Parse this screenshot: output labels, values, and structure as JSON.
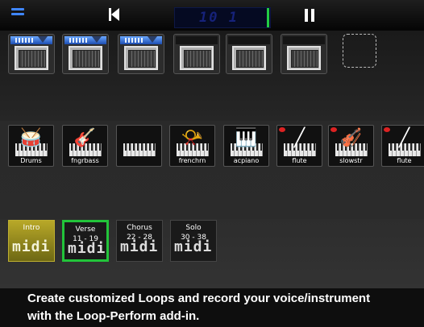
{
  "toolbar": {
    "lcd_text": "10 1",
    "accent": "#3f86ff",
    "lcd_bar_color": "#22cc44"
  },
  "loop_pads": [
    {
      "icon": "loop-pad-speaker-icon",
      "has_waveform": true
    },
    {
      "icon": "loop-pad-speaker-icon",
      "has_waveform": true
    },
    {
      "icon": "loop-pad-speaker-icon",
      "has_waveform": true
    },
    {
      "icon": "loop-pad-speaker-icon",
      "has_waveform": false
    },
    {
      "icon": "loop-pad-speaker-icon",
      "has_waveform": false
    },
    {
      "icon": "loop-pad-speaker-icon",
      "has_waveform": false
    }
  ],
  "instruments": [
    {
      "label": "Drums",
      "icon": "drum-kit-icon",
      "muted": false
    },
    {
      "label": "fngrbass",
      "icon": "bass-guitar-icon",
      "muted": false
    },
    {
      "label": "",
      "icon": "keyboard-icon",
      "muted": false
    },
    {
      "label": "frenchrn",
      "icon": "french-horn-icon",
      "muted": false
    },
    {
      "label": "acpiano",
      "icon": "grand-piano-icon",
      "muted": false
    },
    {
      "label": "flute",
      "icon": "flute-icon",
      "muted": true
    },
    {
      "label": "slowstr",
      "icon": "violin-icon",
      "muted": true
    },
    {
      "label": "flute",
      "icon": "flute-icon",
      "muted": true
    }
  ],
  "sections": [
    {
      "name": "Intro",
      "range": "",
      "selected": false,
      "active": true,
      "midi": "midi"
    },
    {
      "name": "Verse",
      "range": "11 - 19",
      "selected": true,
      "active": false,
      "midi": "midi"
    },
    {
      "name": "Chorus",
      "range": "22 - 28",
      "selected": false,
      "active": false,
      "midi": "midi"
    },
    {
      "name": "Solo",
      "range": "30 - 38",
      "selected": false,
      "active": false,
      "midi": "midi"
    }
  ],
  "caption": {
    "line1": "Create customized Loops and record your voice/instrument",
    "line2": "with the Loop-Perform add-in."
  }
}
